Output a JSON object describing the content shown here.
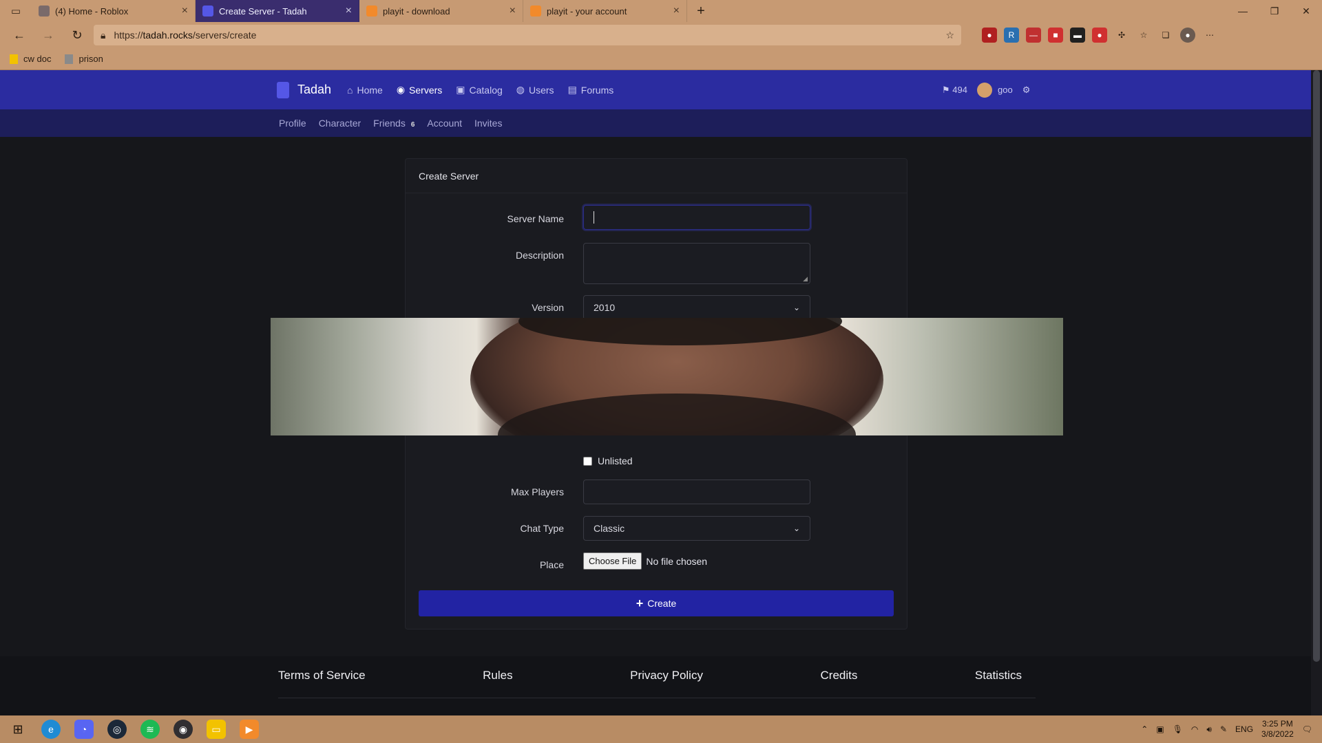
{
  "browser": {
    "tabs": [
      {
        "title": "(4) Home - Roblox",
        "active": false,
        "favicon_color": "#7a6a6a"
      },
      {
        "title": "Create Server - Tadah",
        "active": true,
        "favicon_color": "#5557e6"
      },
      {
        "title": "playit - download",
        "active": false,
        "favicon_color": "#f28a2b"
      },
      {
        "title": "playit - your account",
        "active": false,
        "favicon_color": "#f28a2b"
      }
    ],
    "url_prefix": "https://",
    "url_host": "tadah.rocks",
    "url_path": "/servers/create",
    "bookmarks": [
      {
        "label": "cw doc",
        "icon_color": "#f2c200"
      },
      {
        "label": "prison",
        "icon_color": "#8a8a8a"
      }
    ]
  },
  "site": {
    "brand": "Tadah",
    "nav": [
      {
        "label": "Home",
        "icon": "home-icon",
        "glyph": "⌂",
        "active": false
      },
      {
        "label": "Servers",
        "icon": "gamepad-icon",
        "glyph": "◉",
        "active": true
      },
      {
        "label": "Catalog",
        "icon": "bag-icon",
        "glyph": "▣",
        "active": false
      },
      {
        "label": "Users",
        "icon": "users-icon",
        "glyph": "◍",
        "active": false
      },
      {
        "label": "Forums",
        "icon": "chat-icon",
        "glyph": "▤",
        "active": false
      }
    ],
    "currency": "494",
    "username": "goo",
    "subnav": [
      {
        "label": "Profile"
      },
      {
        "label": "Character"
      },
      {
        "label": "Friends",
        "badge": "6"
      },
      {
        "label": "Account"
      },
      {
        "label": "Invites"
      }
    ]
  },
  "form": {
    "title": "Create Server",
    "server_name_label": "Server Name",
    "server_name_value": "",
    "description_label": "Description",
    "description_value": "",
    "version_label": "Version",
    "version_value": "2010",
    "unlisted_label": "Unlisted",
    "unlisted_checked": false,
    "max_players_label": "Max Players",
    "max_players_value": "",
    "chat_type_label": "Chat Type",
    "chat_type_value": "Classic",
    "place_label": "Place",
    "choose_file_label": "Choose File",
    "file_status": "No file chosen",
    "create_label": "Create"
  },
  "footer": {
    "links": [
      "Terms of Service",
      "Rules",
      "Privacy Policy",
      "Credits",
      "Statistics"
    ]
  },
  "taskbar": {
    "language": "ENG",
    "time": "3:25 PM",
    "date": "3/8/2022"
  },
  "colors": {
    "nav_bg": "#2b2ca0",
    "subnav_bg": "#1d1e5a",
    "page_bg": "#16171b",
    "button_bg": "#2223a3"
  }
}
